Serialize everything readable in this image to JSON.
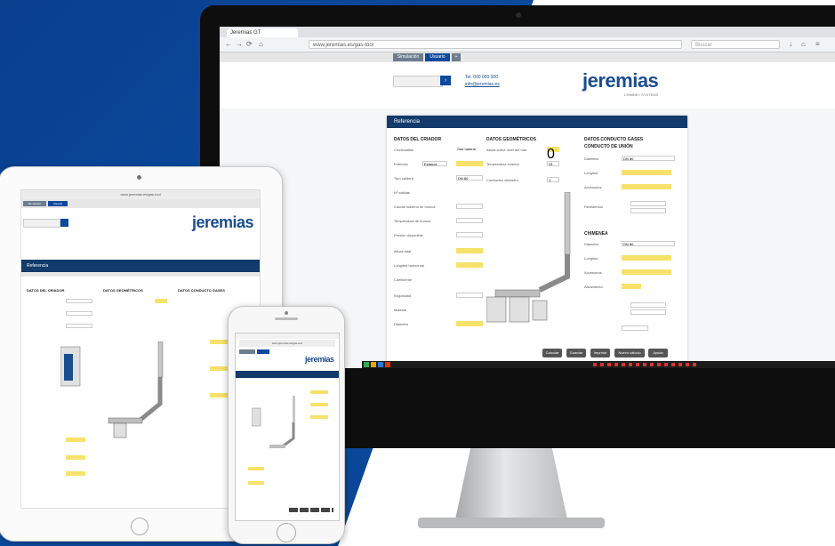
{
  "brand": {
    "name": "jeremias",
    "tagline": "CHIMNEY SYSTEMS",
    "accent": "#1a4d8f",
    "panel_header_color": "#123a6b",
    "highlight_yellow": "#f6e26b"
  },
  "browser": {
    "tab_title": "Jeremias GT",
    "url": "www.jeremias.es/gas-tool",
    "search_placeholder": "Buscar"
  },
  "site": {
    "top_nav": [
      "Simulación",
      "Usuario"
    ],
    "header_info_1": "Tel. 000 000 000",
    "header_info_2": "info@jeremias.es"
  },
  "panel": {
    "title": "Referencia",
    "col1": {
      "title": "DATOS DEL CRIADOR",
      "fields": [
        "Combustible",
        "Potencia",
        "Tipo caldera",
        "Nº salidas",
        "Caudal máximo de humos",
        "Temperatura de humos",
        "Presión disponible",
        "Altura total",
        "Longitud horizontal",
        "Coeficiente",
        "Rugosidad",
        "Material",
        "Diámetro"
      ]
    },
    "col2": {
      "title": "DATOS GEOMÉTRICOS",
      "fields": [
        "Altura sobre nivel del mar",
        "Temperatura exterior",
        "Conductos diámetro"
      ]
    },
    "col3": {
      "title": "DATOS CONDUCTO GASES",
      "subtitle": "CONDUCTO DE UNIÓN",
      "section2": "CHIMENEA",
      "fields": [
        "Diámetro",
        "Longitud",
        "Accesorios",
        "Resistencia",
        "Diámetro",
        "Longitud",
        "Accesorios",
        "Aislamiento"
      ]
    },
    "value_samples": [
      "Gas natural",
      "Estanca",
      "DN 80",
      "0",
      "24",
      "1"
    ],
    "buttons": [
      "Calcular",
      "Guardar",
      "Imprimir",
      "Nuevo cálculo",
      "Ayuda"
    ]
  }
}
